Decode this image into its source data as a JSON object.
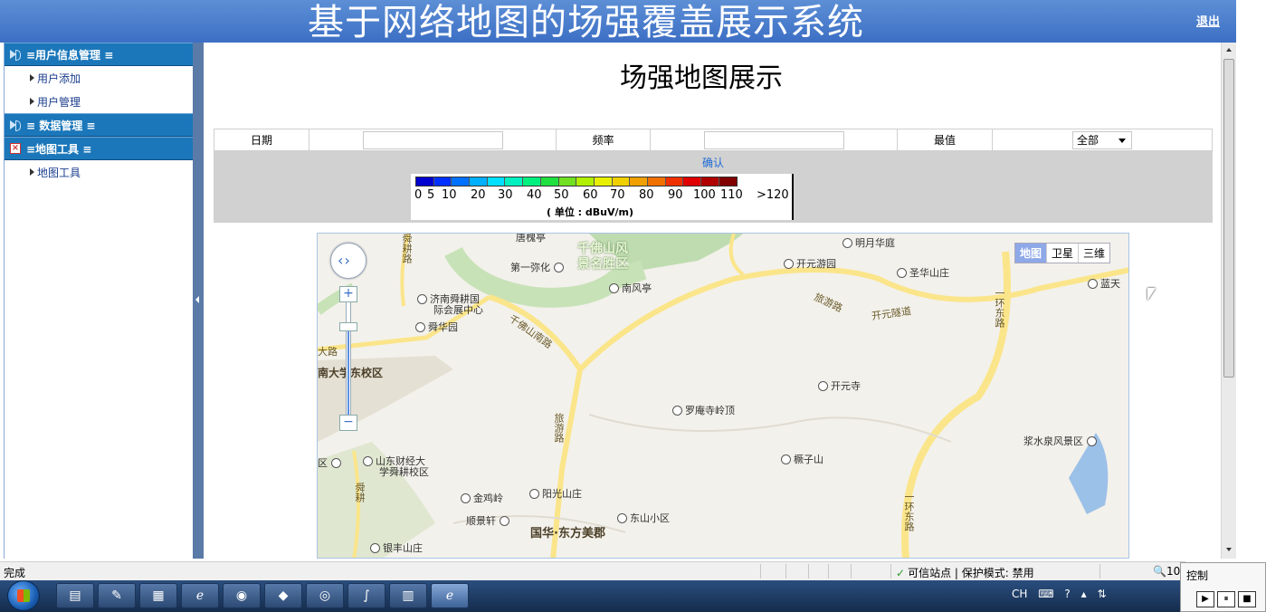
{
  "header": {
    "title": "基于网络地图的场强覆盖展示系统",
    "logout_label": "退出"
  },
  "sidebar": {
    "sections": [
      {
        "label": "≡用户信息管理 ≡",
        "icon": "arrow-icon",
        "items": [
          "用户添加",
          "用户管理"
        ]
      },
      {
        "label": "≡ 数据管理 ≡",
        "icon": "arrow-icon",
        "items": []
      },
      {
        "label": "≡地图工具 ≡",
        "icon": "close-box-icon",
        "items": [
          "地图工具"
        ]
      }
    ]
  },
  "main": {
    "page_title": "场强地图展示",
    "filters": {
      "date_label": "日期",
      "date_value": "",
      "freq_label": "频率",
      "freq_value": "",
      "max_label": "最值",
      "max_selected": "全部"
    },
    "confirm_label": "确认",
    "legend": {
      "ticks": [
        "0",
        "5",
        "10",
        "20",
        "30",
        "40",
        "50",
        "60",
        "70",
        "80",
        "90",
        "100",
        "110",
        ">120"
      ],
      "unit": "( 单位 : dBuV/m)",
      "colors": [
        "#0000d0",
        "#0030ff",
        "#0070ff",
        "#00b0ff",
        "#00e0ff",
        "#00f0c0",
        "#00f080",
        "#20e040",
        "#70e020",
        "#b0f000",
        "#e8f000",
        "#f0d000",
        "#f0a000",
        "#f07000",
        "#f03000",
        "#e00000",
        "#b00000",
        "#800000"
      ]
    },
    "map": {
      "type_buttons": [
        "地图",
        "卫星",
        "三维"
      ],
      "active_type": "地图",
      "labels": {
        "qianfo": "千佛山风",
        "qianfo2": "景名胜区",
        "diyi": "第一弥化",
        "nanfeng": "南风亭",
        "kaiyuanyou": "开元游园",
        "minghua": "明月华庭",
        "shenghua": "圣华山庄",
        "lantian": "蓝天",
        "jinan_exp": "济南舜耕国",
        "jinan_exp2": "际会展中心",
        "shunhua": "舜华园",
        "qianfo_rd": "千佛山南路",
        "lvyou_rd": "旅游路",
        "kaiyuan_tunnel": "开元隧道",
        "yihuan_e": "一环东路",
        "dalu": "大路",
        "nanda": "南大学东校区",
        "kaiyuansi": "开元寺",
        "luoan": "罗庵寺岭顶",
        "lvyou_rd2": "旅游路",
        "jianzi": "橛子山",
        "jiangshui": "浆水泉风景区",
        "shanda_cj": "山东财经大",
        "shanda_cj2": "学舜耕校区",
        "jinjiling": "金鸡岭",
        "yangguang": "阳光山庄",
        "dongshan": "东山小区",
        "shunjing": "顺景轩",
        "guohua": "国华·东方美郡",
        "yinfeng": "银丰山庄",
        "yihuan_e2": "一环东路",
        "tangzi": "唐槐亭",
        "shungeng": "舜耕路",
        "shungeng2": "舜耕",
        "qu": "区"
      }
    }
  },
  "statusbar": {
    "left": "完成",
    "trust": "可信站点 | 保护模式: 禁用",
    "zoom": "10"
  },
  "taskbar": {
    "tray_lang": "CH",
    "ctrl_popup_title": "控制"
  }
}
